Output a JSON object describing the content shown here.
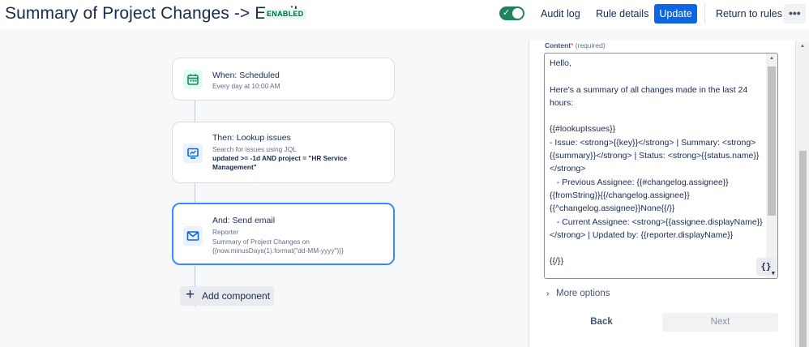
{
  "header": {
    "title": "Summary of Project Changes -> Email",
    "status": "ENABLED",
    "toggle_check": "✓",
    "audit_log": "Audit log",
    "rule_details": "Rule details",
    "update": "Update",
    "return_to_rules": "Return to rules",
    "more_icon": "•••"
  },
  "steps": [
    {
      "title": "When: Scheduled",
      "subtitle": "Every day at 10:00 AM",
      "icon": "calendar-icon",
      "icon_bg": "#dcfff1",
      "icon_color": "#1f845a"
    },
    {
      "title": "Then: Lookup issues",
      "subtitle": "Search for issues using JQL",
      "jql": "updated >= -1d AND project = \"HR Service Management\"",
      "icon": "monitor-icon",
      "icon_bg": "#e9f2ff",
      "icon_color": "#0c66e4"
    },
    {
      "title": "And: Send email",
      "subtitle": "Reporter",
      "detail": "Summary of Project Changes on {{now.minusDays(1).format(\"dd-MM-yyyy\")}}",
      "icon": "mail-icon",
      "icon_bg": "#e9f2ff",
      "icon_color": "#0c66e4"
    }
  ],
  "add_component": {
    "plus": "+",
    "label": "Add component"
  },
  "panel": {
    "content_label": "Content",
    "required_star": "*",
    "required_hint": "(required)",
    "content_value": "Hello,\n\nHere's a summary of all changes made in the last 24 hours:\n\n{{#lookupIssues}}\n- Issue: <strong>{{key}}</strong> | Summary: <strong>{{summary}}</strong> | Status: <strong>{{status.name}}</strong>\n   - Previous Assignee: {{#changelog.assignee}}{{fromString}}{{/changelog.assignee}}{{^changelog.assignee}}None{{/}}\n   - Current Assignee: <strong>{{assignee.displayName}}</strong> | Updated by: {{reporter.displayName}}\n\n{{/}}",
    "smart_value": "{}",
    "more_options": "More options",
    "back": "Back",
    "next": "Next"
  },
  "colors": {
    "primary": "#0c66e4",
    "toggle_on": "#1f845a",
    "selected_border": "#388bff"
  }
}
